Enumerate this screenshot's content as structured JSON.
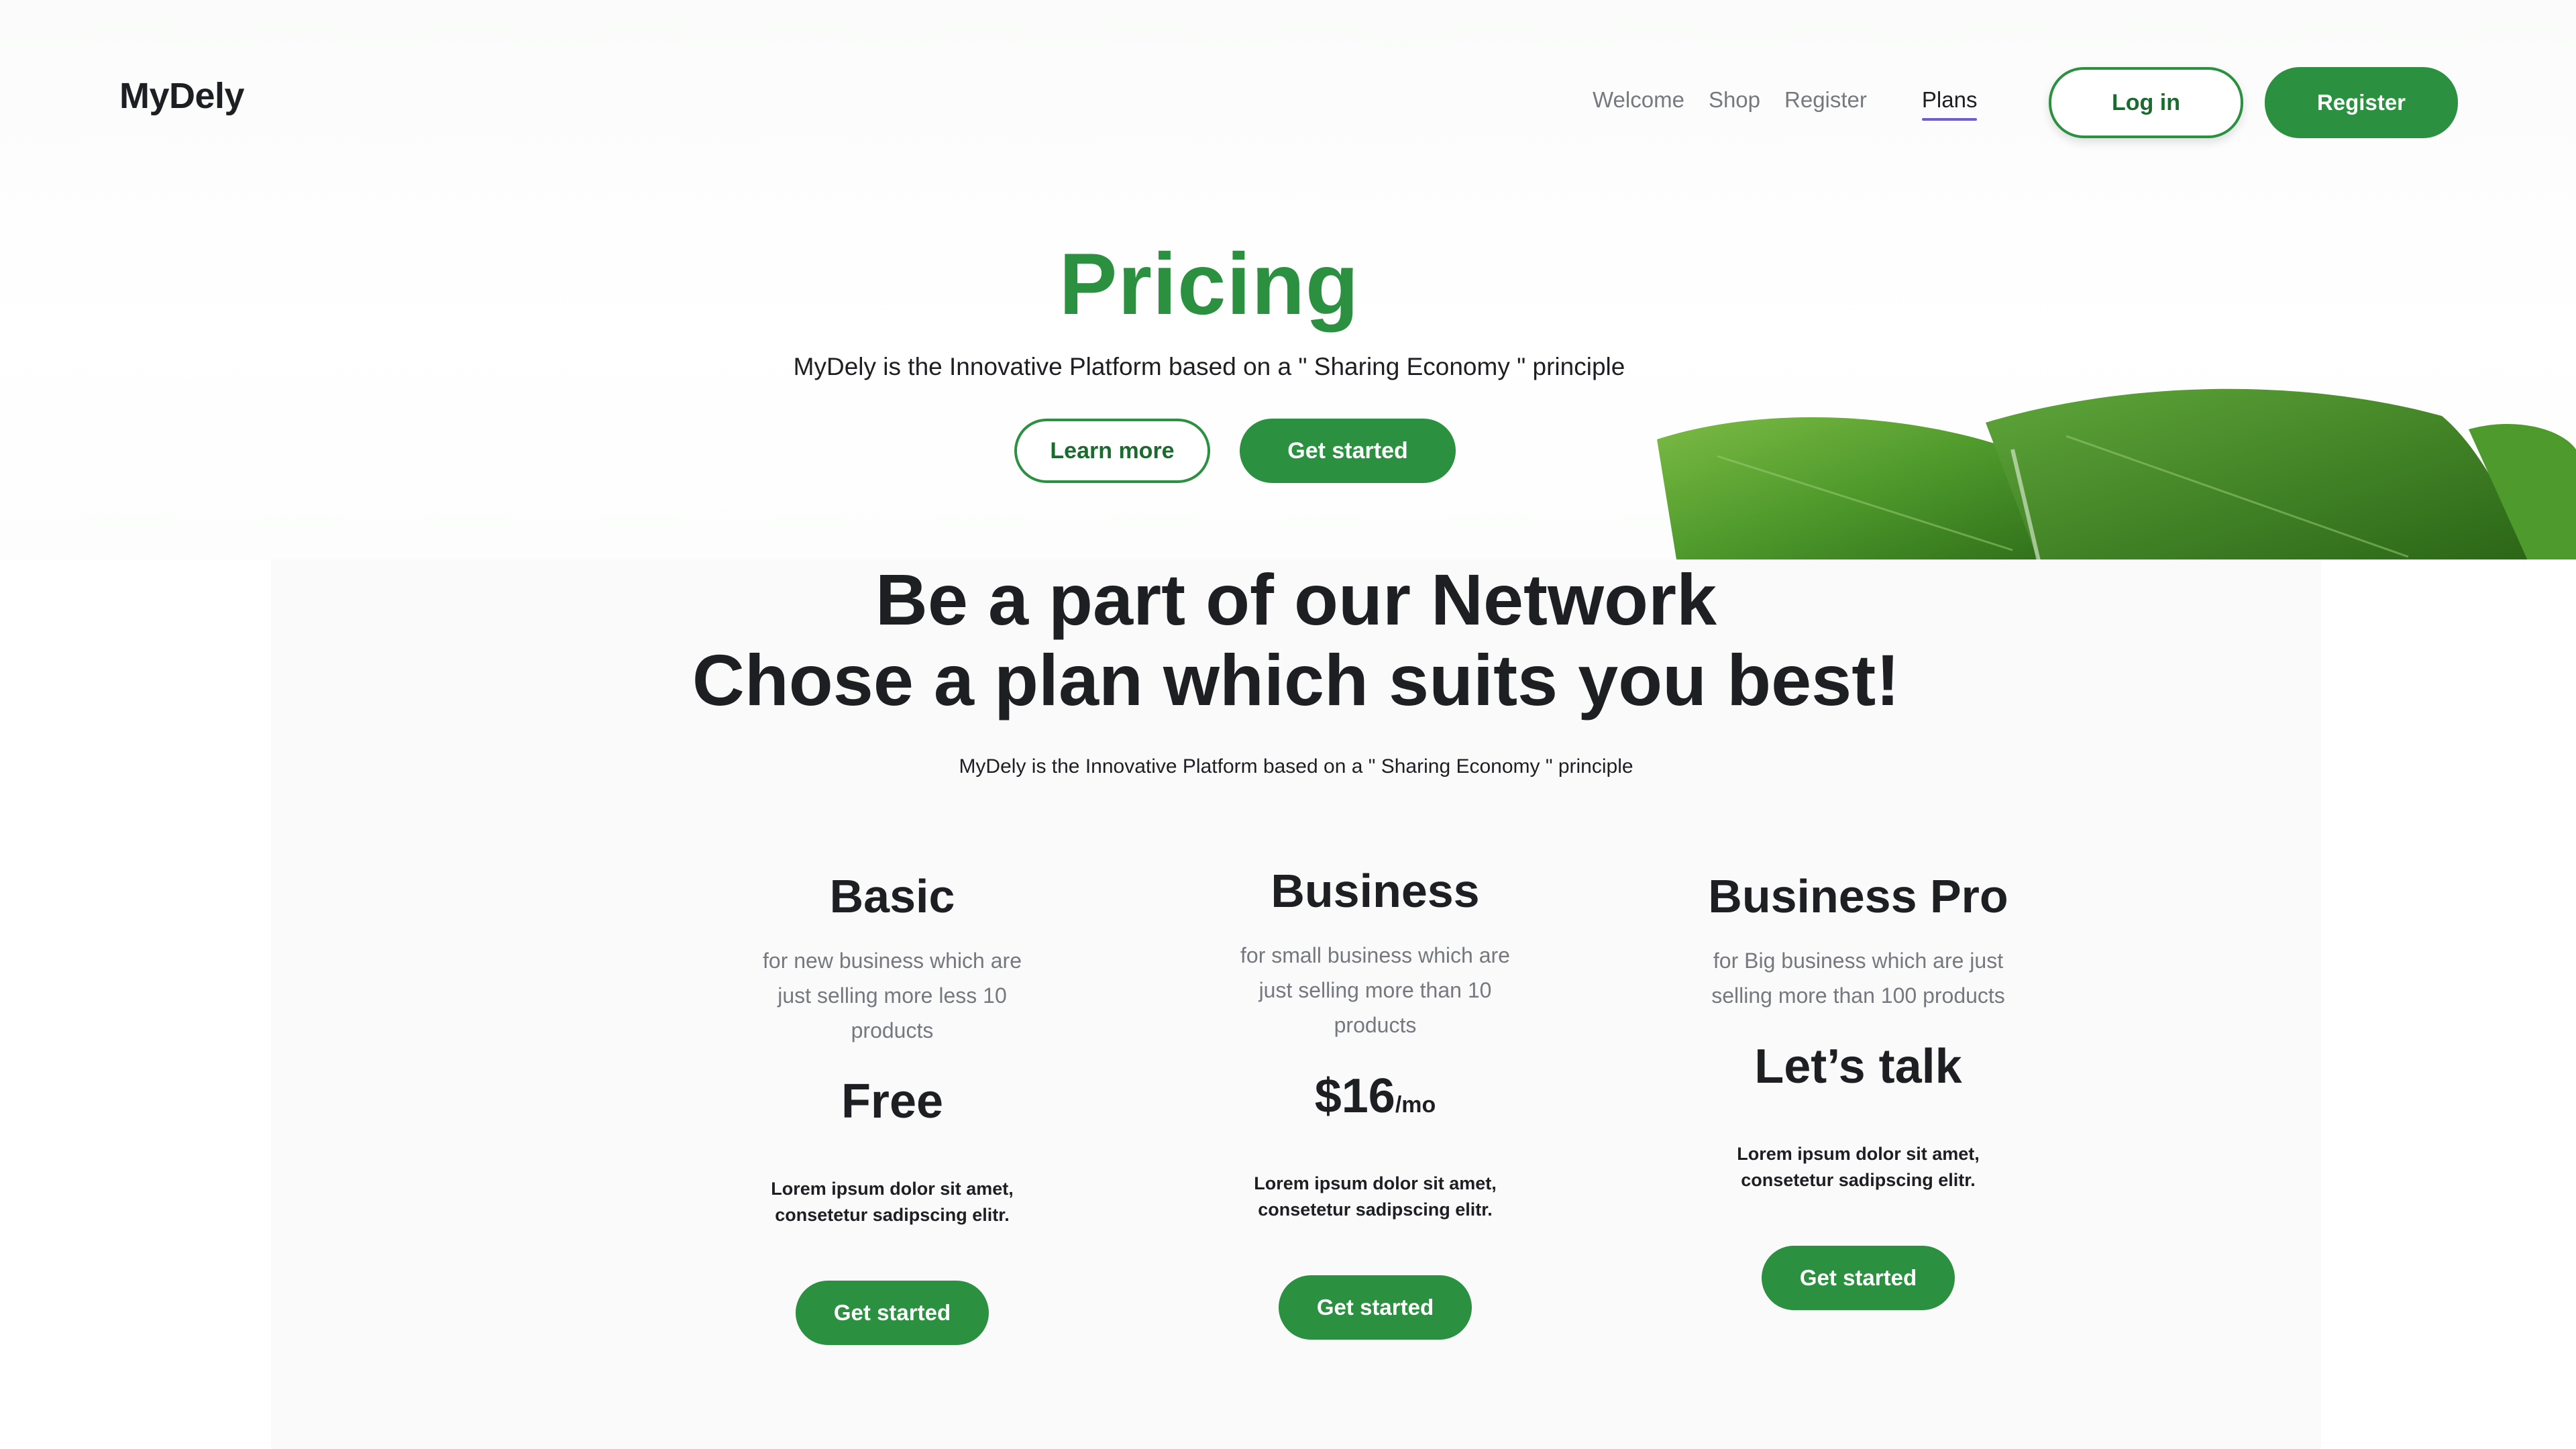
{
  "brand": {
    "logo": "MyDely",
    "green": "#2b9140",
    "accent_underline": "#6e5bd6"
  },
  "nav": {
    "links": [
      "Welcome",
      "Shop",
      "Register"
    ],
    "active": "Plans",
    "login": "Log in",
    "register": "Register"
  },
  "hero": {
    "title": "Pricing",
    "subtitle": "MyDely is the Innovative Platform based on a \" Sharing Economy \" principle",
    "learn_more": "Learn more",
    "get_started": "Get started"
  },
  "network": {
    "title_line1": "Be a part of our Network",
    "title_line2": "Chose a plan which suits you best!",
    "subtitle": "MyDely is the Innovative Platform based on a \" Sharing Economy \" principle"
  },
  "plans": [
    {
      "name": "Basic",
      "description": "for new business which are just selling more less 10 products",
      "price": "Free",
      "period": "",
      "details": "Lorem ipsum dolor sit amet, consetetur sadipscing elitr.",
      "cta": "Get started"
    },
    {
      "name": "Business",
      "description": "for small business which are just selling more than 10 products",
      "price": "$16",
      "period": "/mo",
      "details": "Lorem ipsum dolor sit amet, consetetur sadipscing elitr.",
      "cta": "Get started"
    },
    {
      "name": "Business Pro",
      "description": "for Big business which are just selling more than 100 products",
      "price": "Let’s talk",
      "period": "",
      "details": "Lorem ipsum dolor sit amet, consetetur sadipscing elitr.",
      "cta": "Get started"
    }
  ]
}
